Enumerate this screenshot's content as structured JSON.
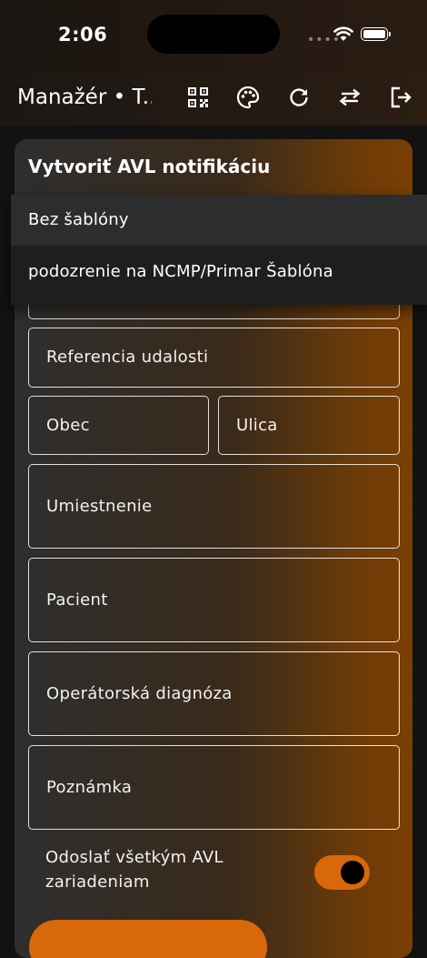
{
  "status_bar": {
    "time": "2:06",
    "dots": "••••"
  },
  "app_bar": {
    "title": "Manažér • T..."
  },
  "form": {
    "title": "Vytvoriť AVL notifikáciu",
    "fields": {
      "reference": "Referencia udalosti",
      "obec": "Obec",
      "ulica": "Ulica",
      "umiestnenie": "Umiestnenie",
      "pacient": "Pacient",
      "diagnoza": "Operátorská diagnóza",
      "poznamka": "Poznámka"
    },
    "toggle_label": "Odoslať všetkým AVL zariadeniam",
    "toggle_on": true
  },
  "template_menu": {
    "items": [
      "Bez šablóny",
      "podozrenie na NCMP/Primar Šablóna"
    ],
    "selected": "Bez šablóny"
  },
  "colors": {
    "accent": "#d9680a",
    "background": "#121212",
    "menu": "#1e1e1e"
  }
}
